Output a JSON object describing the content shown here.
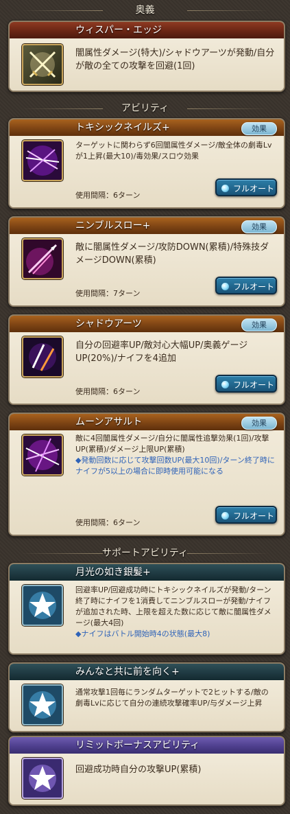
{
  "sections": {
    "ougi": "奥義",
    "abilities": "アビリティ",
    "support": "サポートアビリティ"
  },
  "ougi": {
    "name": "ウィスパー・エッジ",
    "desc": "闇属性ダメージ(特大)/シャドウアーツが発動/自分が敵の全ての攻撃を回避(1回)"
  },
  "abilities": [
    {
      "name": "トキシックネイルズ+",
      "desc": "ターゲットに関わらず6回闇属性ダメージ/敵全体の劇毒Lvが1上昇(最大10)/毒効果/スロウ効果",
      "note": "",
      "cooldown": "使用間隔：6ターン",
      "effect_label": "効果",
      "auto_label": "フルオート"
    },
    {
      "name": "ニンブルスロー+",
      "desc": "敵に闇属性ダメージ/攻防DOWN(累積)/特殊技ダメージDOWN(累積)",
      "note": "",
      "cooldown": "使用間隔：7ターン",
      "effect_label": "効果",
      "auto_label": "フルオート"
    },
    {
      "name": "シャドウアーツ",
      "desc": "自分の回避率UP/敵対心大幅UP/奥義ゲージUP(20%)/ナイフを4追加",
      "note": "",
      "cooldown": "使用間隔：6ターン",
      "effect_label": "効果",
      "auto_label": "フルオート"
    },
    {
      "name": "ムーンアサルト",
      "desc": "敵に4回闇属性ダメージ/自分に闇属性追撃効果(1回)/攻撃UP(累積)/ダメージ上限UP(累積)",
      "note": "◆発動回数に応じて攻撃回数UP(最大10回)/ターン終了時にナイフが5以上の場合に即時使用可能になる",
      "cooldown": "使用間隔：6ターン",
      "effect_label": "効果",
      "auto_label": "フルオート"
    }
  ],
  "supports": [
    {
      "name": "月光の如き銀髪+",
      "desc": "回避率UP/回避成功時にトキシックネイルズが発動/ターン終了時にナイフを1消費してニンブルスローが発動/ナイフが追加された時、上限を超えた数に応じて敵に闇属性ダメージ(最大4回)",
      "note": "◆ナイフはバトル開始時4の状態(最大8)"
    },
    {
      "name": "みんなと共に前を向く+",
      "desc": "通常攻撃1回毎にランダムターゲットで2ヒットする/敵の劇毒Lvに応じて自分の連続攻撃確率UP/与ダメージ上昇",
      "note": ""
    },
    {
      "name": "リミットボーナスアビリティ",
      "desc": "回避成功時自分の攻撃UP(累積)",
      "note": ""
    }
  ]
}
